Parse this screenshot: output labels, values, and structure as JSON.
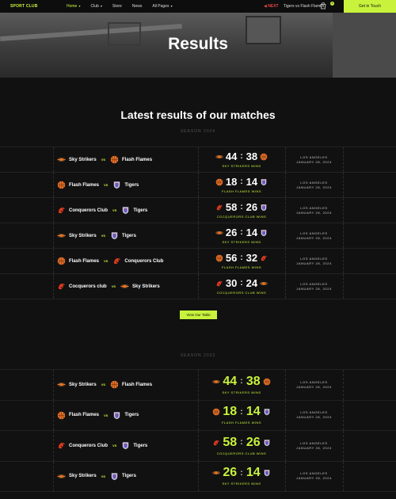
{
  "nav": {
    "logo": "SPORT CLUB",
    "items": [
      {
        "label": "Home"
      },
      {
        "label": "Club"
      },
      {
        "label": "Store"
      },
      {
        "label": "News"
      },
      {
        "label": "All Pages"
      }
    ],
    "next_label": "NEXT",
    "next_match": "Tigers vs Flash Flames",
    "cart_count": "0",
    "cta": "Get in Touch"
  },
  "hero": {
    "title": "Results"
  },
  "section_title": "Latest results of our matches",
  "season_2024": "SEASON 2024",
  "season_2023": "SEASON 2023",
  "vs": "VS",
  "button": "View Our Table",
  "results_2024": [
    {
      "home": "Sky Strikers",
      "away": "Flash Flames",
      "home_score": "44",
      "away_score": "38",
      "winner": "SKY STRIKERS WINS",
      "city": "LOS ANGELES",
      "date": "JANUARY 28, 2024",
      "home_logo": "stripes",
      "away_logo": "ball"
    },
    {
      "home": "Flash Flames",
      "away": "Tigers",
      "home_score": "18",
      "away_score": "14",
      "winner": "FLASH FLAMES WINS",
      "city": "LOS ANGELES",
      "date": "JANUARY 28, 2024",
      "home_logo": "ball",
      "away_logo": "shield"
    },
    {
      "home": "Conquerors Club",
      "away": "Tigers",
      "home_score": "58",
      "away_score": "26",
      "winner": "COCQUERORS CLUB WINS",
      "city": "LOS ANGELES",
      "date": "JANUARY 28, 2024",
      "home_logo": "bird",
      "away_logo": "shield"
    },
    {
      "home": "Sky Strikers",
      "away": "Tigers",
      "home_score": "26",
      "away_score": "14",
      "winner": "SKY STRIKERS WINS",
      "city": "LOS ANGELES",
      "date": "JANUARY 28, 2024",
      "home_logo": "stripes",
      "away_logo": "shield"
    },
    {
      "home": "Flash Flames",
      "away": "Conquerors Club",
      "home_score": "56",
      "away_score": "32",
      "winner": "FLASH FLAMES WINS",
      "city": "LOS ANGELES",
      "date": "JANUARY 28, 2024",
      "home_logo": "ball",
      "away_logo": "bird"
    },
    {
      "home": "Cocquerors club",
      "away": "Sky Strikers",
      "home_score": "30",
      "away_score": "24",
      "winner": "COCQUERORS CLUB WINS",
      "city": "LOS ANGELES",
      "date": "JANUARY 28, 2024",
      "home_logo": "bird",
      "away_logo": "stripes"
    }
  ],
  "results_2023": [
    {
      "home": "Sky Strikers",
      "away": "Flash Flames",
      "home_score": "44",
      "away_score": "38",
      "winner": "SKY STRIKERS WINS",
      "city": "LOS ANGELES",
      "date": "JANUARY 28, 2024",
      "home_logo": "stripes",
      "away_logo": "ball"
    },
    {
      "home": "Flash Flames",
      "away": "Tigers",
      "home_score": "18",
      "away_score": "14",
      "winner": "FLASH FLAMES WINS",
      "city": "LOS ANGELES",
      "date": "JANUARY 28, 2024",
      "home_logo": "ball",
      "away_logo": "shield"
    },
    {
      "home": "Conquerors Club",
      "away": "Tigers",
      "home_score": "58",
      "away_score": "26",
      "winner": "COCQUERORS CLUB WINS",
      "city": "LOS ANGELES",
      "date": "JANUARY 28, 2024",
      "home_logo": "bird",
      "away_logo": "shield"
    },
    {
      "home": "Sky Strikers",
      "away": "Tigers",
      "home_score": "26",
      "away_score": "14",
      "winner": "SKY STRIKERS WINS",
      "city": "LOS ANGELES",
      "date": "JANUARY 28, 2024",
      "home_logo": "stripes",
      "away_logo": "shield"
    }
  ],
  "colors": {
    "accent": "#c8f23c",
    "background": "#111111",
    "alert": "#e04646"
  }
}
